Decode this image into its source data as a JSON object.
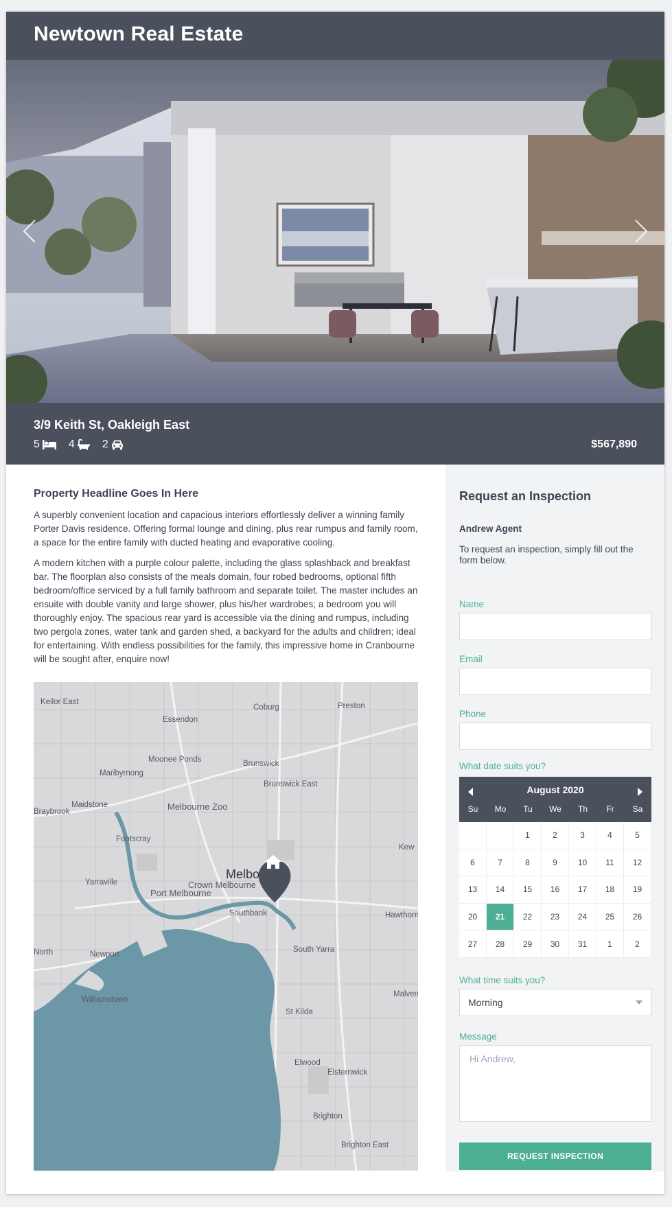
{
  "header": {
    "brand": "Newtown Real Estate"
  },
  "listing": {
    "address": "3/9 Keith St, Oakleigh East",
    "bedrooms": "5",
    "bathrooms": "4",
    "parking": "2",
    "price": "$567,890",
    "headline": "Property Headline Goes In Here",
    "description": [
      "A superbly convenient location and capacious interiors effortlessly deliver a winning family Porter Davis residence. Offering formal lounge and dining, plus rear rumpus and family room, a space for the entire family with ducted heating and evaporative cooling.",
      "A modern kitchen with a purple colour palette, including the glass splashback and breakfast bar. The floorplan also consists of the meals domain, four robed bedrooms, optional fifth bedroom/office serviced by a full family bathroom and separate toilet. The master includes an ensuite with double vanity and large shower, plus his/her wardrobes; a bedroom you will thoroughly enjoy. The spacious rear yard is accessible via the dining and rumpus, including two pergola zones, water tank and garden shed, a backyard for the adults and children; ideal for entertaining. With endless possibilities for the family, this impressive home in Cranbourne will be sought after, enquire now!"
    ]
  },
  "map": {
    "labels": [
      "Keilor East",
      "Coburg",
      "Preston",
      "Essendon",
      "Moonee Ponds",
      "Brunswick",
      "Brunswick East",
      "Maribyrnong",
      "Maidstone",
      "Melbourne Zoo",
      "Braybrook",
      "Footscray",
      "Yarraville",
      "Port Melbourne",
      "Crown Melbourne",
      "Melbourne",
      "Southbank",
      "South Yarra",
      "Newport",
      "North",
      "Williamstown",
      "St Kilda",
      "Elwood",
      "Elsternwick",
      "Brighton",
      "Brighton East",
      "Kew",
      "Hawthorn",
      "Malvern"
    ]
  },
  "form": {
    "title": "Request an Inspection",
    "agent": "Andrew Agent",
    "intro": "To request an inspection, simply fill out the form below.",
    "name_label": "Name",
    "email_label": "Email",
    "phone_label": "Phone",
    "date_label": "What date suits you?",
    "time_label": "What time suits you?",
    "time_value": "Morning",
    "message_label": "Message",
    "message_placeholder": "Hi Andrew,",
    "submit_label": "REQUEST INSPECTION"
  },
  "calendar": {
    "month": "August 2020",
    "weekdays": [
      "Su",
      "Mo",
      "Tu",
      "We",
      "Th",
      "Fr",
      "Sa"
    ],
    "days": [
      "",
      "",
      "1",
      "2",
      "3",
      "4",
      "5",
      "6",
      "7",
      "8",
      "9",
      "10",
      "11",
      "12",
      "13",
      "14",
      "15",
      "16",
      "17",
      "18",
      "19",
      "20",
      "21",
      "22",
      "23",
      "24",
      "25",
      "26",
      "27",
      "28",
      "29",
      "30",
      "31",
      "1",
      "2"
    ],
    "selected": "21"
  },
  "colors": {
    "header_bg": "#4a505c",
    "accent": "#4caf93",
    "panel_bg": "#f2f3f5",
    "water": "#6c97a6"
  }
}
